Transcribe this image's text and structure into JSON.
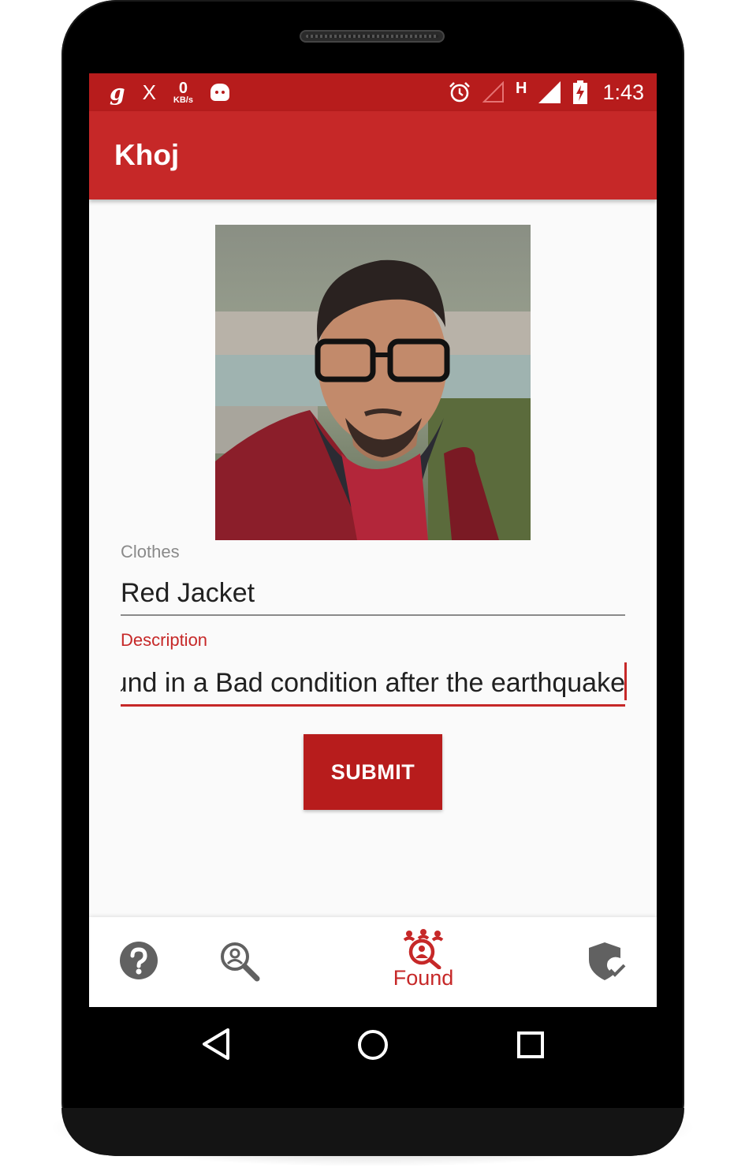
{
  "status_bar": {
    "left_icons": [
      "gaana-g-icon",
      "x-icon",
      "network-speed",
      "android-robot-icon"
    ],
    "g_glyph": "g",
    "x_glyph": "X",
    "speed_value": "0",
    "speed_unit": "KB/s",
    "right_icons": [
      "alarm-icon",
      "signal-empty-icon",
      "h-network-icon",
      "signal-full-icon",
      "battery-charging-icon"
    ],
    "network_type": "H",
    "time": "1:43"
  },
  "app_bar": {
    "title": "Khoj"
  },
  "form": {
    "photo_icon": "person-photo",
    "clothes_label": "Clothes",
    "clothes_value": "Red Jacket",
    "description_label": "Description",
    "description_value": "Found in a Bad condition after the earthquake",
    "submit_label": "SUBMIT"
  },
  "bottom_nav": {
    "items": [
      {
        "icon": "help-icon",
        "label": ""
      },
      {
        "icon": "search-person-icon",
        "label": ""
      },
      {
        "icon": "found-icon",
        "label": "Found",
        "active": true
      },
      {
        "icon": "shield-check-icon",
        "label": ""
      }
    ]
  },
  "colors": {
    "primary": "#c62828",
    "primary_dark": "#b71c1c",
    "inactive_icon": "#616161"
  }
}
